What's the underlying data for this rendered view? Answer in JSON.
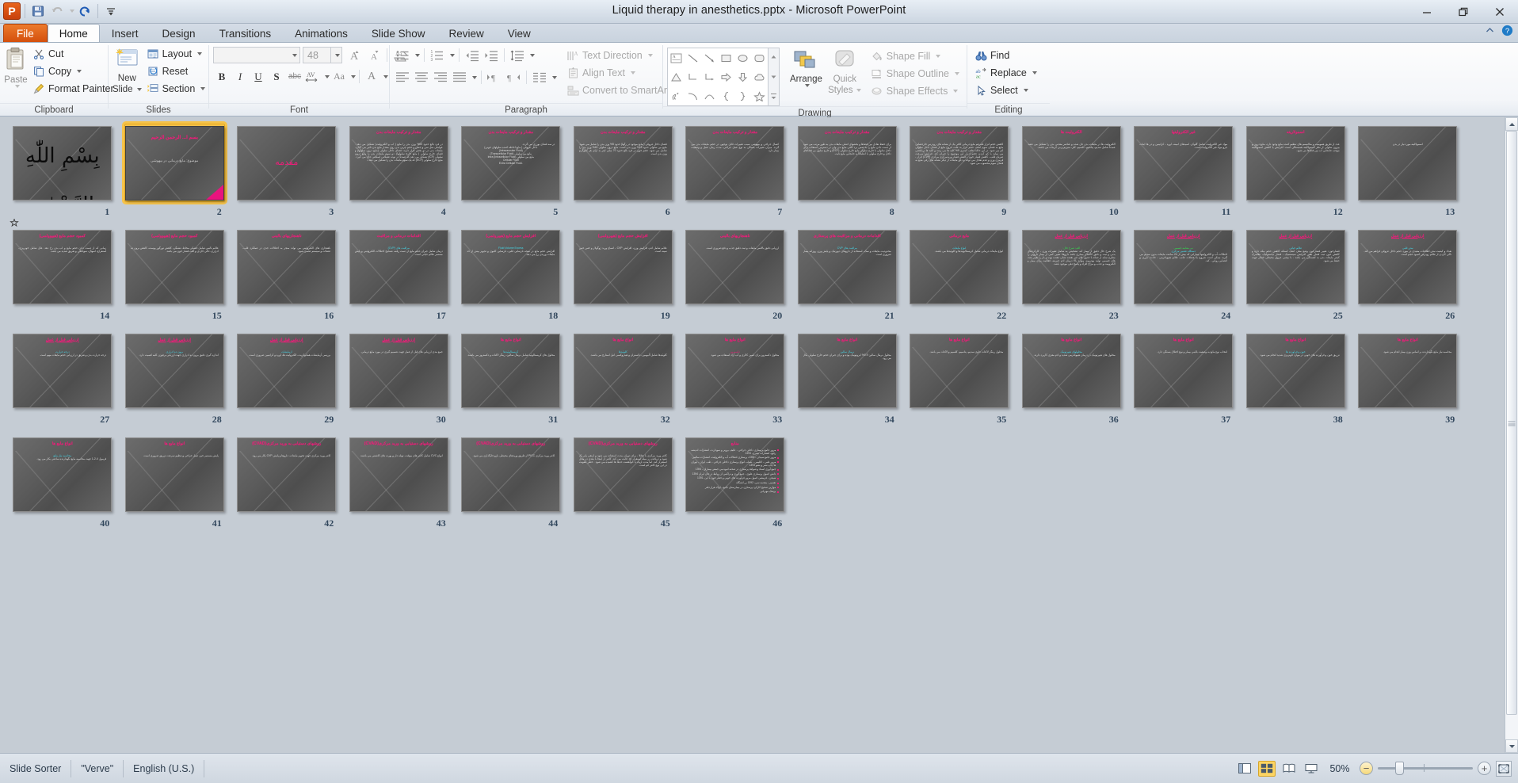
{
  "window": {
    "title": "Liquid therapy in anesthetics.pptx  -  Microsoft PowerPoint",
    "app_logo": "powerpoint-logo",
    "minimize": "minimize-icon",
    "restore": "restore-icon",
    "close": "close-icon"
  },
  "quick_access": [
    {
      "name": "save-icon",
      "label": "Save"
    },
    {
      "name": "undo-icon",
      "label": "Undo"
    },
    {
      "name": "redo-icon",
      "label": "Redo"
    },
    {
      "name": "customize-qat-icon",
      "label": "Customize Quick Access Toolbar"
    }
  ],
  "ribbon": {
    "tabs": [
      {
        "label": "File",
        "active": false,
        "file": true
      },
      {
        "label": "Home",
        "active": true
      },
      {
        "label": "Insert",
        "active": false
      },
      {
        "label": "Design",
        "active": false
      },
      {
        "label": "Transitions",
        "active": false
      },
      {
        "label": "Animations",
        "active": false
      },
      {
        "label": "Slide Show",
        "active": false
      },
      {
        "label": "Review",
        "active": false
      },
      {
        "label": "View",
        "active": false
      }
    ],
    "minimize_ribbon": "chevron-up-icon",
    "help": "help-icon",
    "groups": {
      "clipboard": {
        "label": "Clipboard",
        "paste": "Paste",
        "cut": "Cut",
        "copy": "Copy",
        "format_painter": "Format Painter"
      },
      "slides": {
        "label": "Slides",
        "new_slide": "New\nSlide",
        "new_slide_line1": "New",
        "new_slide_line2": "Slide",
        "layout": "Layout",
        "reset": "Reset",
        "section": "Section"
      },
      "font": {
        "label": "Font",
        "font_name": "",
        "font_name_placeholder": "",
        "font_size": "48",
        "grow_font": "A",
        "shrink_font": "A",
        "clear_formatting": "clear-formatting-icon",
        "bold": "B",
        "italic": "I",
        "underline": "U",
        "shadow": "S",
        "strikethrough": "abc",
        "character_spacing": "AV",
        "change_case": "Aa",
        "font_color": "A"
      },
      "paragraph": {
        "label": "Paragraph",
        "bullets": "bullets-icon",
        "numbering": "numbering-icon",
        "decrease_indent": "decrease-indent-icon",
        "increase_indent": "increase-indent-icon",
        "line_spacing": "line-spacing-icon",
        "align_left": "align-left-icon",
        "align_center": "align-center-icon",
        "align_right": "align-right-icon",
        "justify": "justify-icon",
        "ltr": "ltr-icon",
        "rtl": "rtl-icon",
        "columns": "columns-icon",
        "text_direction": "Text Direction",
        "align_text": "Align Text",
        "convert_to_smartart": "Convert to SmartArt"
      },
      "drawing": {
        "label": "Drawing",
        "arrange": "Arrange",
        "quick_styles_line1": "Quick",
        "quick_styles_line2": "Styles",
        "shape_fill": "Shape Fill",
        "shape_outline": "Shape Outline",
        "shape_effects": "Shape Effects",
        "shapes": [
          "textbox",
          "line",
          "arrow",
          "rectangle",
          "oval",
          "rounded-rectangle",
          "triangle",
          "elbow-connector",
          "elbow-arrow-connector",
          "right-arrow",
          "down-arrow",
          "cloud",
          "scribble",
          "curve",
          "arc",
          "left-brace",
          "right-brace",
          "star"
        ]
      },
      "editing": {
        "label": "Editing",
        "find": "Find",
        "replace": "Replace",
        "select": "Select"
      }
    }
  },
  "status_bar": {
    "view_name": "Slide Sorter",
    "theme": "\"Verve\"",
    "language": "English (U.S.)",
    "view_buttons": [
      {
        "name": "view-normal",
        "active": false
      },
      {
        "name": "view-slide-sorter",
        "active": true
      },
      {
        "name": "view-reading",
        "active": false
      },
      {
        "name": "view-slide-show",
        "active": false
      }
    ],
    "zoom_level": "50%",
    "zoom_out": "−",
    "zoom_in": "+",
    "fit_to_window": "fit-slide-to-window-icon"
  },
  "sorter": {
    "selected_slide": 2,
    "columns": 11,
    "slides": [
      {
        "n": 1,
        "kind": "bismillah",
        "glyph": "بِسْمِ اللّٰهِ الرَّحْمٰنِ الرَّحِيمِ",
        "animated": true
      },
      {
        "n": 2,
        "kind": "title",
        "title": "بسم ا... الرحمن الرحیم",
        "subtitle": "موضوع: مایع درمانی در بیهوشی",
        "corner": true
      },
      {
        "n": 3,
        "kind": "section",
        "title": "مقدمه"
      },
      {
        "n": 4,
        "kind": "content",
        "title": "مقدار و ترکیب مایعات بدن",
        "body": "در فرد بالغ حدود 60% وزن بدن را مایع ( آب و الکترولیت) تشکیل می دهد . عواملی مثل سن و جنس و حجم چربی بدن روی مقدار مایع بدن تاثیر می گذارد. مایعات بدن در دو بخش قرار دارند: فضای داخل سلولی (مایع درون سلولها) و فضای خارج سلولی ( مایع خارج سلولها). دو سوم مایعات بدن را مایع درون سلولی (ICF) تشکیل می دهد که عمدتاً در توده عضلانی اسکلتی جای می گیرد . مایع خارج سلولی (ECF) که یک سوم مایعات بدن را تشکیل می دهد د"
      },
      {
        "n": 5,
        "kind": "content",
        "title": "مقدار و ترکیب مایعات بدن",
        "body": "در سه فضای بورژی می گردد.",
        "lines": [
          "داخل عروقی ( مایع احاطه کننده سلولهای خونی)",
          "(Intravascular Fluid)",
          "مایع بین سلولی (Transcellular Fluid)",
          "مایع بین سلولی Intra (Intracellular Fluid)",
          "Cellular Fluid",
          "-Extra Cellular Fluid"
        ]
      },
      {
        "n": 6,
        "kind": "content",
        "title": "مقدار و ترکیب مایعات بدن",
        "body": "فضای داخل عروقی ( مایع موجود در رگها) حدود 5% وزن بدن را شامل می شود. مایع بین سلولی حدود 15% وزن بدن است. مایع درون سلولی 40% وزن بدن را شامل می شود. حجم خون در فرد بالغ حدود 70 میلی لیتر به ازای هر کیلوگرم وزن بدن است."
      },
      {
        "n": 7,
        "kind": "content",
        "title": "مقدار و ترکیب مایعات بدن",
        "body": "اعمال جراحی و بیهوشی سبب تغییرات قابل توجهی در حجم مایعات بدن می گردد. میزان تغییرات بستگی به نوع عمل جراحی، مدت زمان عمل و وضعیت بیمار دارد."
      },
      {
        "n": 8,
        "kind": "content",
        "title": "مقدار و ترکیب مایعات بدن",
        "body": "برای حفظ تعادل بین فضاها و بخشهای اصلی مایعات بدن به طور مرتب می شود از دست دادن مایع را به ضمن برد کافی مایع بدن ولی در دسترس استفاده برای داخل سلولی با خارج سلولی مایع خارج سلولی (ECF) و خارج سلول بی فضاهای داخل و خارج سلولی با انطباقاً به جابجایی مایع ثابت."
      },
      {
        "n": 9,
        "kind": "content",
        "title": "مقدار و ترکیب مایعات بدن",
        "body": "کاهش حجم انزار علیرغم مایع درمانی کافی یک از نشانه های زودرس خارجشانی مایع به فضای سوم است. حجم انزار به علت خروج مایع از فضای داخل سلولی کم می شود. در این حالت خلف کمتری 9% کلیه ها می رسد و کلیه ها بر بعضی می نماید با کم کردن حجم ادرار این موضوع را جبران کند. فزایش سرعت ضربان قلب ، کاهش فشار خون ، کاهش فشار وریدمرکزی مرکزی (CVP) ادرار ، قرمزی وزن و عدم تعادل می تواند و دلق مایعات از دیگر نشانه های رفی مایع به فضای سوم محسوب می شود."
      },
      {
        "n": 10,
        "kind": "content",
        "title": "الکترولیت ها",
        "body": "الکترولیت ها در مایعات بدن حل شده و عناصر معدنی بدن را تشکیل می دهند. عمدتاً شامل سدیم، پتاسیم، کلسیم، کلر، منیزیم و بی کربنات می باشند."
      },
      {
        "n": 11,
        "kind": "content",
        "title": "غیر الکترولیتها",
        "body": "مواد غیر الکترولیت شامل گلوکز، اسیدهای آمینه، اوره ، کراتینین و در ها اینات جزو مواد غیر الکترولیت است."
      },
      {
        "n": 12,
        "kind": "content",
        "title": "اسمولاریته",
        "body": "عدد از طریق همومیت و مکانیسم های تنظیم کننده مایع وجود دارد، مایع درون و بیرون سلولی از نظر اسمولالیته همبستگی است. افزایش یا کاهش اسمولالیته موجب جابجایی آب بین فضاها می شود."
      },
      {
        "n": 13,
        "kind": "content",
        "title": "",
        "body": "",
        "lines": [
          "اسمولالیته مورد نیاز در بدن"
        ]
      },
      {
        "n": 14,
        "kind": "content",
        "title": "کمبود حجم مایع (هیپوولمی)",
        "body": "زمانی که از دست دادن حجم مایع و آب بدن رخ دهد. علل شامل خونریزی، استفراغ، اسهال، سوختگی و تعریق شدید می باشد."
      },
      {
        "n": 15,
        "kind": "content",
        "title": "کمبود حجم مایع (هیپوولمی)",
        "body": "علائم بالینی شامل خشکی مخاط، تشنگی، کاهش تورگور پوست، کاهش برون ده ادراری، تاکی کاردی و افت فشار خون می باشد."
      },
      {
        "n": 16,
        "kind": "content",
        "title": "ناهنجاریهای بالینی",
        "body": "ناهنجاری های الکترولیتی می تواند منجر به اختلالات جدی در عملکرد قلب، عضلات و سیستم عصبی شود."
      },
      {
        "n": 17,
        "kind": "content",
        "title": "اقدامات درمانی و مراقبت",
        "body": "درمان شامل جبران حجم مایع از دست رفته، تصحیح اختلالات الکترولیتی و پایش مستمر علائم حیاتی است.",
        "hl": "مراقبت های (CVP)"
      },
      {
        "n": 18,
        "kind": "content",
        "title": "افزایش حجم مایع (هیپرولمی)",
        "body": "افزایش حجم مایع در نتیجه نارسایی قلبی، نارسایی کلیوی و تجویز بیش از حد مایعات وریدی رخ می دهد.",
        "hl": "Fluid Volume Excess"
      },
      {
        "n": 19,
        "kind": "content",
        "title": "افزایش حجم مایع (هیپرولمی)",
        "body": "علائم شامل ادم، افزایش وزن، افزایش CVP ، اتساع ورید ژوگولار و خس خس سینه است."
      },
      {
        "n": 20,
        "kind": "content",
        "title": "ناهنجاریهای بالینی",
        "body": "ارزیابی دقیق بالانس مایعات و ثبت دقیق جذب و دفع ضروری است."
      },
      {
        "n": 21,
        "kind": "content",
        "title": "اقدامات درمانی و مراقبت های پرستاری",
        "body": "محدودیت مایعات و نمک، استفاده از داروهای دیورتیک و پایش وزن روزانه بیمار ضروری است.",
        "hl": "مراقبت های CVP"
      },
      {
        "n": 22,
        "kind": "content",
        "title": "مایع درمانی",
        "body": "انواع مایعات درمانی شامل کریستالوئیدها و کلوئیدها می باشند.",
        "hl": "انواع مایعات"
      },
      {
        "n": 23,
        "kind": "content",
        "title": "ارزیابی قبل از عمل",
        "underline": true,
        "hl_green": "الف: شرح حال:",
        "body": "یک شرح حال دقیق از بیمار که، تشخیص به شامل تغییرات وزن ، کارکردهای بدنی و ثبت و دقیق کالاهای بیماری باشد داروها: تعیین کمی از بیمار دارویی را مطرح نماید از جمله با جدول های غیر نقشه نشان دهنده بوده و باز را تغییر بعث های جسمی تولید بهدروبه، موارد بالا درمان ادم جبریته، فقالیت برای بیمار و الکترومت و جذب و مزاج افراد و پاسخ دهی موجود باشد."
      },
      {
        "n": 24,
        "kind": "content",
        "title": "ارزیابی قبل از عمل",
        "underline": true,
        "hl_green": "ب- معاینه جسمی",
        "hl_cyan": "دستگاه عصبی مرکزی",
        "body": "اختلالات آب و الکترولیتها بیمارانی که بیش از 24 ساعت مایعات بدون سدیم می گیرند ممکن است شروع به عضلات جانب علائم هیپوناترمی ، حادث نارزی و اعضایی روانی ، کند."
      },
      {
        "n": 25,
        "kind": "content",
        "title": "ارزیابی قبل از عمل",
        "underline": true,
        "hl_cyan": "علائم حیاتی",
        "body": "فشارخون: تغییر فشارخون وضع منلز، اشک استکه کاهش حجم بیکه داره و کاهش خون ثبت فشار بعض افزایش سیستمیک ، فشار دیاستولیک، نطامرک کمتر مایعات بدن به آهستگی می باشد ، با بیشی عروق محیطی فشار جهت حفظ می شود."
      },
      {
        "n": 26,
        "kind": "content",
        "title": "ارزیابی قبل از عمل",
        "underline": true,
        "hl_cyan": "نبض قلبی",
        "body": "تعداد و کیفیت نبض اطلاعات مفیدی در مورد حجم داخل عروقی فراهم می کند. تاکی کاردی از علائم زودرس کمبود حجم است."
      },
      {
        "n": 27,
        "kind": "content",
        "title": "ارزیابی قبل از عمل",
        "underline": true,
        "hl_cyan": "درجه حرارت",
        "body": "درجه حرارت بدن و تعریق در ارزیابی حجم مایعات مهم است."
      },
      {
        "n": 28,
        "kind": "content",
        "title": "ارزیابی قبل از عمل",
        "underline": true,
        "hl_cyan": "برون ده ادراری",
        "body": "اندازه گیری دقیق برون ده ادراری جهت ارزیابی پرفوژن کلیه اهمیت دارد."
      },
      {
        "n": 29,
        "kind": "content",
        "title": "ارزیابی قبل از عمل",
        "underline": true,
        "hl_cyan": "آزمایشات",
        "body": "بررسی آزمایشات هماتوکریت، الکترولیت ها، اوره و کراتینین ضروری است."
      },
      {
        "n": 30,
        "kind": "content",
        "title": "ارزیابی قبل از عمل",
        "underline": true,
        "body": "جمع بندی ارزیابی های قبل از عمل جهت تصمیم گیری در مورد مایع درمانی."
      },
      {
        "n": 31,
        "kind": "content",
        "title": "انواع مایع ها",
        "hl_cyan": "کریستالوئیدها",
        "body": "محلول های کریستالوئید شامل نرمال سالین، رینگر لاکتات و دکستروز می باشند."
      },
      {
        "n": 32,
        "kind": "content",
        "title": "انواع مایع ها",
        "hl_cyan": "کلوئیدها",
        "body": "کلوئیدها شامل آلبومین، دکستران و هیدروکسی اتیل استارچ می باشند."
      },
      {
        "n": 33,
        "kind": "content",
        "title": "انواع مایع ها",
        "hl_pink": "دکستروز",
        "body": "محلول دکستروز برای تامین کالری و آب آزاد استفاده می شود."
      },
      {
        "n": 34,
        "kind": "content",
        "title": "انواع مایع ها",
        "hl_cyan": "نرمال سالین",
        "body": "محلول نرمال سالین 0.9% ایزوتونیک بوده و برای جبران حجم خارج سلولی بکار می رود."
      },
      {
        "n": 35,
        "kind": "content",
        "title": "انواع مایع ها",
        "body": "محلول رینگر لاکتات حاوی سدیم، پتاسیم، کلسیم و لاکتات می باشد."
      },
      {
        "n": 36,
        "kind": "content",
        "title": "انواع مایع ها",
        "hl_cyan": "محلولهای هیپرتونیک",
        "body": "محلول های هیپرتونیک در درمان هیپوناترمی شدید و ادم مغزی کاربرد دارند."
      },
      {
        "n": 37,
        "kind": "content",
        "title": "انواع مایع ها",
        "body": "انتخاب نوع مایع به وضعیت بالینی بیمار و نوع اختلال بستگی دارد."
      },
      {
        "n": 38,
        "kind": "content",
        "title": "انواع مایع ها",
        "hl_cyan": "خون و فرآورده ها",
        "body": "تزریق خون و فرآورده های خونی در موارد خونریزی شدید انجام می شود."
      },
      {
        "n": 39,
        "kind": "content",
        "title": "انواع مایع ها",
        "body": "محاسبه نیاز مایع نگهدارنده بر اساس وزن بیمار انجام می شود."
      },
      {
        "n": 40,
        "kind": "content",
        "title": "انواع مایع ها",
        "hl_cyan": "محاسبه نیاز مایع",
        "body": "فرمول 4-2-1 جهت محاسبه مایع نگهدارنده ساعتی بکار می رود."
      },
      {
        "n": 41,
        "kind": "content",
        "title": "انواع مایع ها",
        "body": "پایش مستمر حین عمل جراحی و تنظیم سرعت تزریق ضروری است."
      },
      {
        "n": 42,
        "kind": "content",
        "title": "روشهای دستیابی به ورید مرکزی(CVAD)",
        "body": "کاتتر ورید مرکزی جهت تجویز مایعات، داروها و پایش CVP بکار می رود."
      },
      {
        "n": 43,
        "kind": "content",
        "title": "روشهای دستیابی به ورید مرکزی(CVAD)",
        "body": "انواع CVC شامل کاتتر های موقت، تونله دار و پورت های کاشتنی می باشند."
      },
      {
        "n": 44,
        "kind": "content",
        "title": "روشهای دستیابی به ورید مرکزی(CVAD)",
        "body": "کاتتر ورید مرکزی PICC از طریق وریدهای محیطی بازو جایگذاری می شود."
      },
      {
        "n": 45,
        "kind": "content",
        "title": "روشهای دستیابی به ورید مرکزی(CVAD)",
        "body": "کاتتر ورید مرکزی با تجللا ، برای دوران مدت استفاده می شود و ارتقی پایر یک شود و دریافت رر میله استقرار لح. فابت می کند. کاتتر از اینجا با بعدی در محل استقرار کند. اما مدت اریک با خواهشت حدها ها کشیده می شود . خطر عفونت در این نوع کاتتر کم است."
      },
      {
        "n": 46,
        "kind": "bullets",
        "title": "منابع",
        "bullets": [
          "مرور جامع پرستاری داخلی جراحی ، تالیف برونر و سودارث، انتشارات اندیشه رفیع، انتشارات بشری، 1393",
          "مرور جامع سیدان ، 1392، پرستاری اصلالات آب و الکترولیت، انتشارات سالمی",
          "مرور طبی ، اقلیمی ، شباب انواع پرستاری داخلی جراحی ، طب ایران ، تهران ها چاپ نشر و نشو 1393",
          "جمع آوری اسناد و شواهد پرستاری در صحنه انبوه می جمعی بیماران ، 1394",
          "دانش اصول پرستاری علوی ، جمع آوری و تراکمی از روابط در جان ایران 1394",
          "شیحن ، فرمشی اصول مرور فرآورده های خونی و خطر خون یا این، 1391",
          "تفسیر ، مقدمه سی، 1392 زر انشگاه",
          "موازین صحیح کارکرد پرستاری در بیمارستان جامع ، اولاد هرار دفتر",
          "پزشک مهربانی"
        ]
      }
    ]
  }
}
